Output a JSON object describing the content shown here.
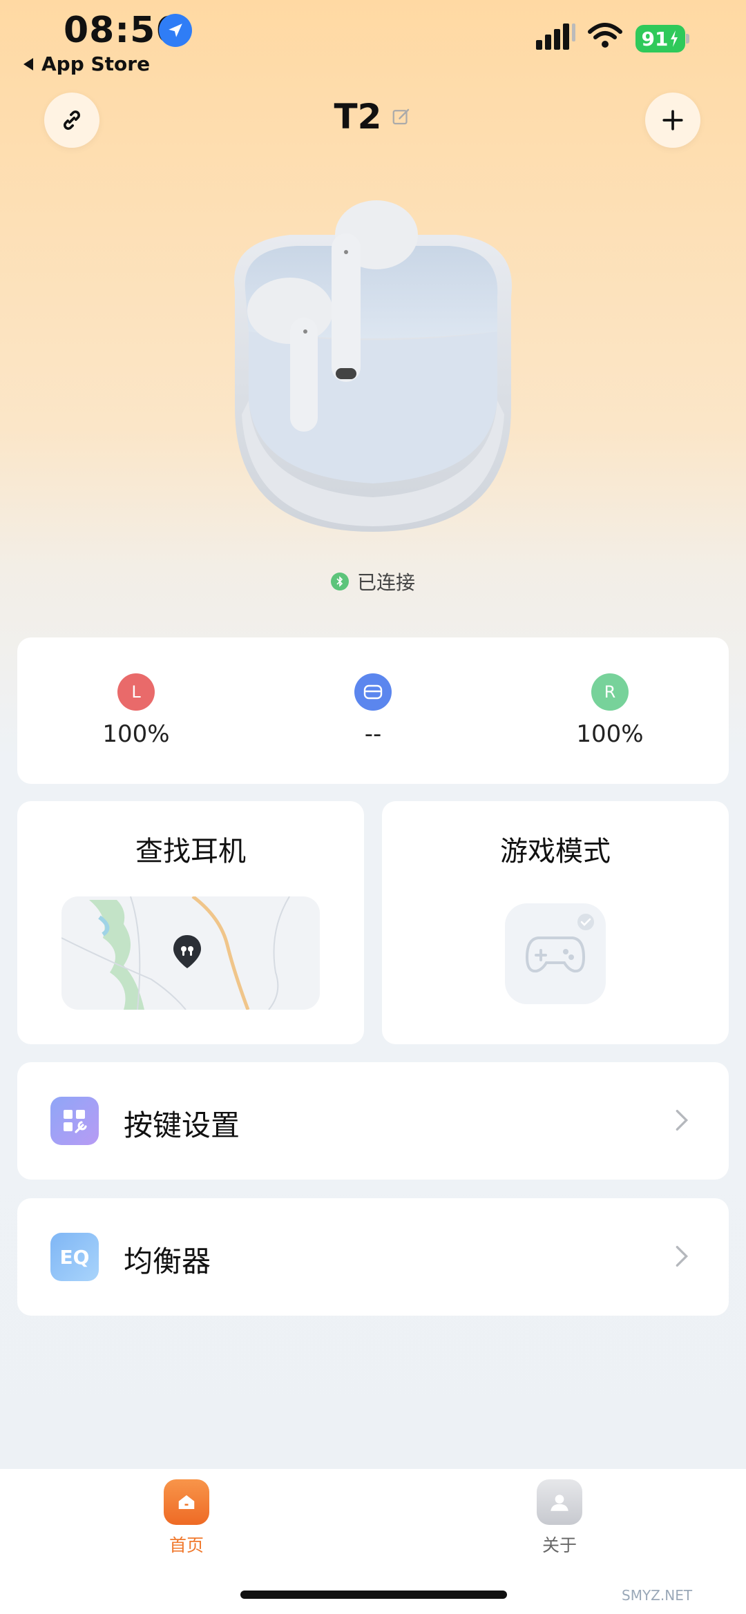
{
  "status_bar": {
    "time": "08:56",
    "back_app": "App Store",
    "battery": "91",
    "icons": [
      "location-arrow-icon",
      "cellular-signal-icon",
      "wifi-icon",
      "battery-charging-icon"
    ]
  },
  "header": {
    "title": "T2",
    "icons": [
      "link-icon",
      "edit-icon",
      "plus-icon"
    ]
  },
  "device": {
    "connection_status": "已连接",
    "status_icon": "bluetooth-icon"
  },
  "battery": {
    "left": {
      "badge": "L",
      "value": "100%",
      "color": "#e96a6a"
    },
    "case": {
      "value": "--",
      "color": "#5b86ee",
      "icon": "case-icon"
    },
    "right": {
      "badge": "R",
      "value": "100%",
      "color": "#77d29a"
    }
  },
  "features": {
    "find": {
      "title": "查找耳机",
      "icon": "map-pin-icon"
    },
    "game": {
      "title": "游戏模式",
      "icon": "gamepad-icon",
      "enabled": false
    }
  },
  "menu": [
    {
      "label": "按键设置",
      "icon": "grid-wrench-icon"
    },
    {
      "label": "均衡器",
      "icon_text": "EQ"
    }
  ],
  "tabbar": {
    "tabs": [
      {
        "label": "首页",
        "icon": "home-icon",
        "active": true
      },
      {
        "label": "关于",
        "icon": "user-icon",
        "active": false
      }
    ],
    "active_color": "#f0782c"
  },
  "watermark": "SMYZ.NET"
}
